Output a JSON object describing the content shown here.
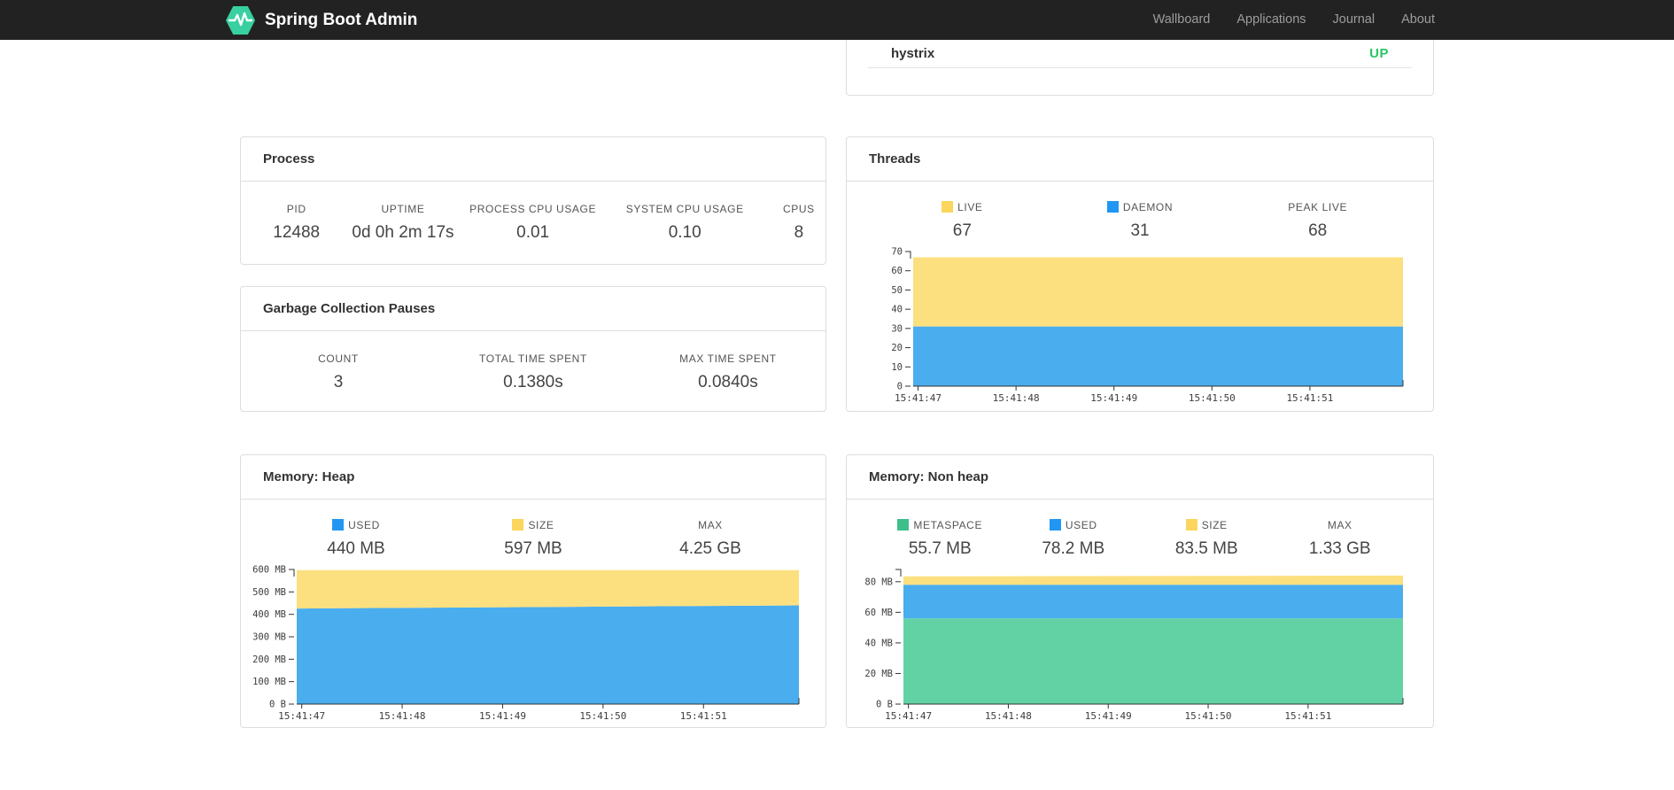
{
  "navbar": {
    "brand": "Spring Boot Admin",
    "logo_color": "#38d0a0",
    "items": [
      {
        "label": "Wallboard"
      },
      {
        "label": "Applications"
      },
      {
        "label": "Journal"
      },
      {
        "label": "About"
      }
    ]
  },
  "service": {
    "name": "hystrix",
    "status": "UP",
    "status_color": "#29c664"
  },
  "process": {
    "title": "Process",
    "metrics": [
      {
        "label": "PID",
        "value": "12488"
      },
      {
        "label": "UPTIME",
        "value": "0d 0h 2m 17s"
      },
      {
        "label": "PROCESS CPU USAGE",
        "value": "0.01"
      },
      {
        "label": "SYSTEM CPU USAGE",
        "value": "0.10"
      },
      {
        "label": "CPUS",
        "value": "8"
      }
    ]
  },
  "gc": {
    "title": "Garbage Collection Pauses",
    "metrics": [
      {
        "label": "COUNT",
        "value": "3"
      },
      {
        "label": "TOTAL TIME SPENT",
        "value": "0.1380s"
      },
      {
        "label": "MAX TIME SPENT",
        "value": "0.0840s"
      }
    ]
  },
  "threads": {
    "title": "Threads",
    "metrics": [
      {
        "label": "LIVE",
        "value": "67",
        "swatch": "#fbd55c"
      },
      {
        "label": "DAEMON",
        "value": "31",
        "swatch": "#2196f3"
      },
      {
        "label": "PEAK LIVE",
        "value": "68"
      }
    ]
  },
  "memory_heap": {
    "title": "Memory: Heap",
    "metrics": [
      {
        "label": "USED",
        "value": "440 MB",
        "swatch": "#2196f3"
      },
      {
        "label": "SIZE",
        "value": "597 MB",
        "swatch": "#fbd55c"
      },
      {
        "label": "MAX",
        "value": "4.25 GB"
      }
    ]
  },
  "memory_nonheap": {
    "title": "Memory: Non heap",
    "metrics": [
      {
        "label": "METASPACE",
        "value": "55.7 MB",
        "swatch": "#3dbe8b"
      },
      {
        "label": "USED",
        "value": "78.2 MB",
        "swatch": "#2196f3"
      },
      {
        "label": "SIZE",
        "value": "83.5 MB",
        "swatch": "#fbd55c"
      },
      {
        "label": "MAX",
        "value": "1.33 GB"
      }
    ]
  },
  "chart_data": [
    {
      "type": "area",
      "title": "Threads",
      "stacked": true,
      "ylim": [
        0,
        70
      ],
      "yticks": [
        {
          "v": 0,
          "label": "0"
        },
        {
          "v": 10,
          "label": "10"
        },
        {
          "v": 20,
          "label": "20"
        },
        {
          "v": 30,
          "label": "30"
        },
        {
          "v": 40,
          "label": "40"
        },
        {
          "v": 50,
          "label": "50"
        },
        {
          "v": 60,
          "label": "60"
        },
        {
          "v": 70,
          "label": "70"
        }
      ],
      "xticks": [
        {
          "f": 0.01,
          "label": "15:41:47"
        },
        {
          "f": 0.21,
          "label": "15:41:48"
        },
        {
          "f": 0.41,
          "label": "15:41:49"
        },
        {
          "f": 0.61,
          "label": "15:41:50"
        },
        {
          "f": 0.81,
          "label": "15:41:51"
        }
      ],
      "bands": [
        {
          "name": "DAEMON",
          "color": "#4aadee",
          "top": [
            31,
            31
          ]
        },
        {
          "name": "LIVE",
          "color": "#fce07f",
          "top": [
            67,
            67
          ]
        }
      ]
    },
    {
      "type": "area",
      "title": "Memory: Heap",
      "stacked": true,
      "ylim": [
        0,
        600
      ],
      "yticks": [
        {
          "v": 0,
          "label": "0 B"
        },
        {
          "v": 100,
          "label": "100 MB"
        },
        {
          "v": 200,
          "label": "200 MB"
        },
        {
          "v": 300,
          "label": "300 MB"
        },
        {
          "v": 400,
          "label": "400 MB"
        },
        {
          "v": 500,
          "label": "500 MB"
        },
        {
          "v": 600,
          "label": "600 MB"
        }
      ],
      "xticks": [
        {
          "f": 0.01,
          "label": "15:41:47"
        },
        {
          "f": 0.21,
          "label": "15:41:48"
        },
        {
          "f": 0.41,
          "label": "15:41:49"
        },
        {
          "f": 0.61,
          "label": "15:41:50"
        },
        {
          "f": 0.81,
          "label": "15:41:51"
        }
      ],
      "bands": [
        {
          "name": "USED",
          "color": "#4aadee",
          "top": [
            426,
            440
          ]
        },
        {
          "name": "SIZE",
          "color": "#fce07f",
          "top": [
            597,
            597
          ]
        }
      ]
    },
    {
      "type": "area",
      "title": "Memory: Non heap",
      "stacked": true,
      "ylim": [
        0,
        88
      ],
      "yticks": [
        {
          "v": 0,
          "label": "0 B"
        },
        {
          "v": 20,
          "label": "20 MB"
        },
        {
          "v": 40,
          "label": "40 MB"
        },
        {
          "v": 60,
          "label": "60 MB"
        },
        {
          "v": 80,
          "label": "80 MB"
        }
      ],
      "xticks": [
        {
          "f": 0.01,
          "label": "15:41:47"
        },
        {
          "f": 0.21,
          "label": "15:41:48"
        },
        {
          "f": 0.41,
          "label": "15:41:49"
        },
        {
          "f": 0.61,
          "label": "15:41:50"
        },
        {
          "f": 0.81,
          "label": "15:41:51"
        }
      ],
      "bands": [
        {
          "name": "METASPACE",
          "color": "#62d2a5",
          "top": [
            56,
            56
          ]
        },
        {
          "name": "USED",
          "color": "#4aadee",
          "top": [
            78,
            78
          ]
        },
        {
          "name": "SIZE",
          "color": "#fce07f",
          "top": [
            83.5,
            84
          ]
        }
      ]
    }
  ]
}
